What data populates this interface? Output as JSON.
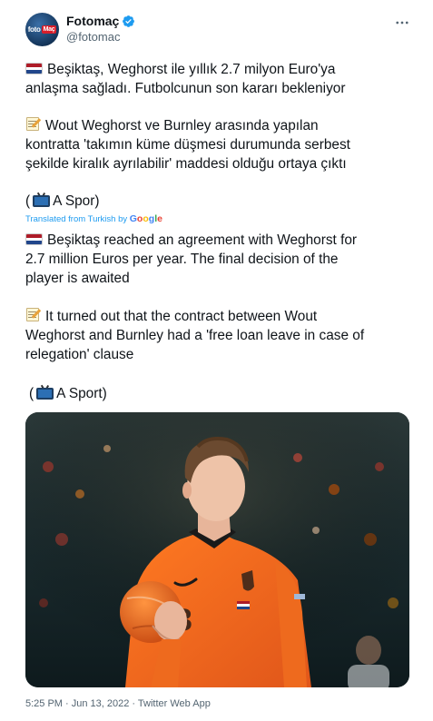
{
  "author": {
    "display_name": "Fotomaç",
    "handle": "@fotomac",
    "avatar_text": "foto",
    "avatar_text_red": "Maç"
  },
  "tweet": {
    "tr_line1": "Beşiktaş, Weghorst ile yıllık 2.7 milyon Euro'ya",
    "tr_line2": "anlaşma sağladı. Futbolcunun son kararı bekleniyor",
    "tr_line3": "Wout Weghorst ve Burnley arasında yapılan",
    "tr_line4": "kontratta 'takımın küme düşmesi durumunda serbest",
    "tr_line5": "şekilde kiralık ayrılabilir' maddesi olduğu ortaya çıktı",
    "tr_source_open": "(",
    "tr_source": "A Spor)",
    "translated_label": "Translated from Turkish by",
    "google": [
      "G",
      "o",
      "o",
      "g",
      "l",
      "e"
    ],
    "en_line1": "Beşiktaş reached an agreement with Weghorst for",
    "en_line2": "2.7 million Euros per year. The final decision of the",
    "en_line3": "player is awaited",
    "en_line4": "It turned out that the contract between Wout",
    "en_line5": "Weghorst and Burnley had a 'free loan leave in case of",
    "en_line6": "relegation' clause",
    "en_source_open": "(",
    "en_source": "A Sport)"
  },
  "footer": {
    "meta": "5:25 PM · Jun 13, 2022 · Twitter Web App"
  },
  "colors": {
    "link": "#1d9bf0",
    "muted": "#536471",
    "jersey": "#f26b1d",
    "netherlands_flag": [
      "#ae1c28",
      "#ffffff",
      "#21468b"
    ]
  },
  "icons": [
    "more-icon",
    "verified-badge-icon",
    "netherlands-flag-icon",
    "memo-icon",
    "tv-icon"
  ]
}
